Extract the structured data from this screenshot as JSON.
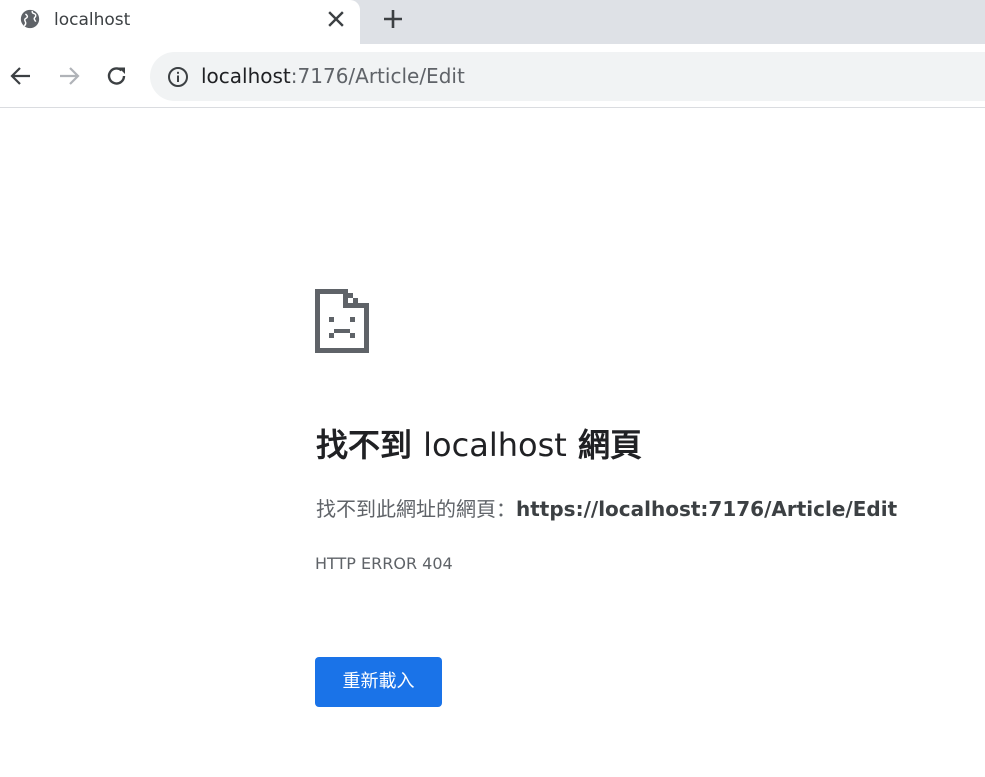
{
  "tab": {
    "title": "localhost",
    "favicon": "globe-icon"
  },
  "omnibox": {
    "host": "localhost",
    "rest": ":7176/Article/Edit"
  },
  "error": {
    "icon": "sad-document-icon",
    "headline_prefix": "找不到 ",
    "headline_host": "localhost",
    "headline_suffix": " 網頁",
    "desc_prefix": "找不到此網址的網頁：",
    "desc_url": "https://localhost:7176/Article/Edit",
    "code": "HTTP ERROR 404",
    "reload_label": "重新載入"
  },
  "colors": {
    "accent": "#1a73e8",
    "tabstrip": "#dee1e6",
    "omnibox": "#f1f3f4"
  }
}
